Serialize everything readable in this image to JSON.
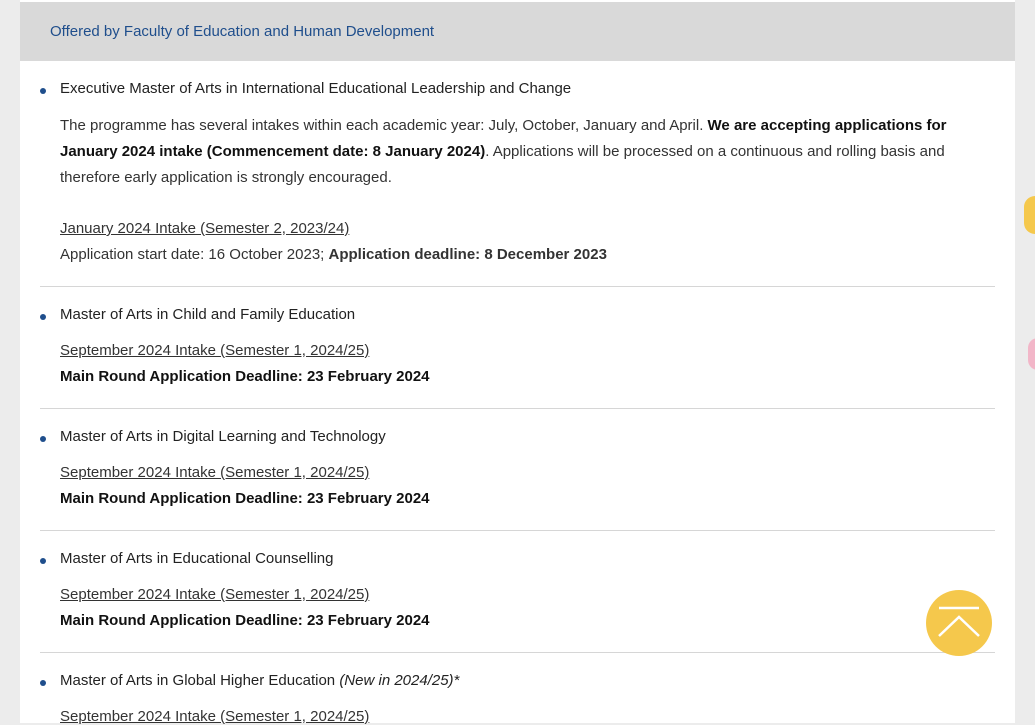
{
  "faculty": {
    "title": "Offered by Faculty of Education and Human Development"
  },
  "programmes": [
    {
      "name": "Executive Master of Arts in International Educational Leadership and Change",
      "description": {
        "intro": "The programme has several intakes within each academic year: July, October, January and April. ",
        "bold": "We are accepting applications for January 2024 intake (Commencement date: 8 January 2024)",
        "outro": ". Applications will be processed on a continuous and rolling basis and therefore early application is strongly encouraged."
      },
      "intake": "January 2024 Intake (Semester 2, 2023/24)",
      "start_label": "Application start date: 16 October 2023; ",
      "deadline": "Application deadline: 8 December 2023"
    },
    {
      "name": "Master of Arts in Child and Family Education",
      "intake": "September 2024 Intake (Semester 1, 2024/25)",
      "deadline": "Main Round Application Deadline: 23 February 2024"
    },
    {
      "name": "Master of Arts in Digital Learning and Technology",
      "intake": "September 2024 Intake (Semester 1, 2024/25)",
      "deadline": "Main Round Application Deadline: 23 February 2024"
    },
    {
      "name": "Master of Arts in Educational Counselling",
      "intake": "September 2024 Intake (Semester 1, 2024/25)",
      "deadline": "Main Round Application Deadline: 23 February 2024"
    },
    {
      "name": "Master of Arts in Global Higher Education",
      "name_tag": "(New in 2024/25)*",
      "intake": "September 2024 Intake (Semester 1, 2024/25)"
    }
  ],
  "colors": {
    "accent": "#1f4e8c",
    "header_bar": "#d9d9d9",
    "back_to_top": "#f5c84c"
  },
  "icons": {
    "back_to_top": "chevron-up-icon"
  }
}
